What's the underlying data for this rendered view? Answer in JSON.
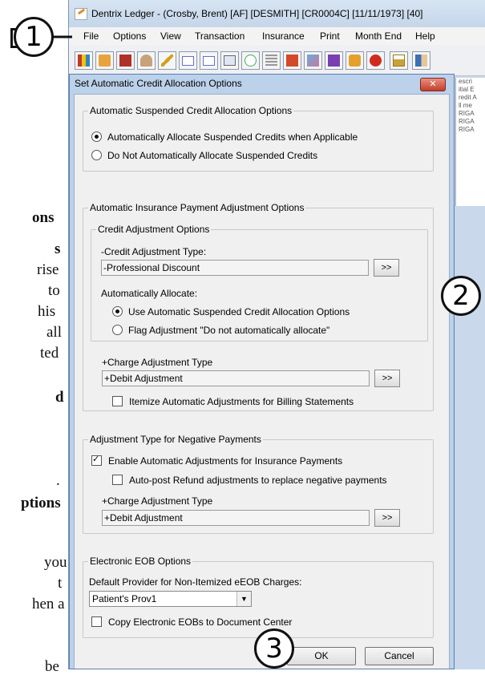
{
  "doc_fragments": [
    "ons",
    "s",
    "rise",
    "to",
    "his",
    "all",
    "ted",
    "d",
    ".",
    "ptions",
    "you",
    "t",
    "hen a",
    "be"
  ],
  "main_window": {
    "title": "Dentrix Ledger - (Crosby, Brent) [AF] [DESMITH] [CR0004C] [11/11/1973] [40]",
    "menu": [
      "File",
      "Options",
      "View",
      "Transaction",
      "Insurance",
      "Print",
      "Month End",
      "Help"
    ],
    "toolbar_icons": [
      "family-file-icon",
      "patient-chart-icon",
      "book-icon",
      "person-icon",
      "pencil-icon",
      "payment-icon",
      "credit-icon",
      "claim-icon",
      "email-icon",
      "calculator-icon",
      "prescription-icon",
      "edit-icon",
      "notebook-icon",
      "treatment-icon",
      "apple-icon",
      "home-icon",
      "patient-icon"
    ],
    "side_list": [
      "escri",
      "itial E",
      "redit A",
      "ll me",
      "RIGA",
      "RIGA",
      "RIGA"
    ]
  },
  "callouts": {
    "c1": "1",
    "c2": "2",
    "c3": "3"
  },
  "dialog": {
    "title": "Set Automatic Credit Allocation Options",
    "close": "✕",
    "suspended": {
      "legend": "Automatic Suspended Credit Allocation Options",
      "opt_auto": "Automatically Allocate Suspended Credits when Applicable",
      "opt_none": "Do Not Automatically Allocate Suspended Credits"
    },
    "insurance": {
      "legend": "Automatic Insurance Payment Adjustment Options",
      "credit": {
        "legend": "Credit Adjustment Options",
        "type_label": "-Credit Adjustment Type:",
        "type_value": "-Professional Discount",
        "more": ">>",
        "allocate_label": "Automatically Allocate:",
        "opt_use": "Use Automatic Suspended Credit Allocation Options",
        "opt_flag": "Flag Adjustment \"Do not automatically allocate\""
      },
      "charge_label": "+Charge Adjustment Type",
      "charge_value": "+Debit Adjustment",
      "more": ">>",
      "itemize": "Itemize Automatic Adjustments for Billing Statements"
    },
    "negative": {
      "legend": "Adjustment Type for Negative Payments",
      "enable": "Enable Automatic Adjustments for Insurance Payments",
      "autopost": "Auto-post Refund adjustments to replace negative payments",
      "charge_label": "+Charge Adjustment Type",
      "charge_value": "+Debit Adjustment",
      "more": ">>"
    },
    "eob": {
      "legend": "Electronic EOB Options",
      "provider_label": "Default Provider for Non-Itemized eEOB Charges:",
      "provider_value": "Patient's Prov1",
      "copy": "Copy Electronic EOBs to Document Center"
    },
    "ok": "OK",
    "cancel": "Cancel"
  }
}
